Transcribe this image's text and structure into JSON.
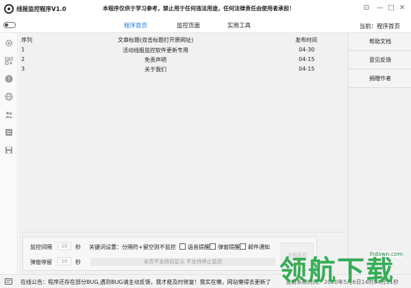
{
  "window": {
    "title": "线报监控程序V1.0",
    "notice": "本程序仅供于学习参考，禁止用于任何违法用途，任何法律责任由使用者承担！",
    "pin_glyph": "⊡",
    "minimize_glyph": "—",
    "maximize_glyph": "□",
    "close_glyph": "✕"
  },
  "nav": {
    "tabs": [
      {
        "label": "程序首页",
        "active": true
      },
      {
        "label": "监控页面",
        "active": false
      },
      {
        "label": "实用工具",
        "active": false
      }
    ],
    "current": "当前：程序首页"
  },
  "table": {
    "headers": [
      "序列",
      "文章标题(双击标题打开原网址)",
      "发布时间"
    ],
    "rows": [
      {
        "seq": "1",
        "title": "活动线报监控软件更新专用",
        "date": "04-30"
      },
      {
        "seq": "2",
        "title": "免责声明",
        "date": "04-15"
      },
      {
        "seq": "3",
        "title": "关于我们",
        "date": "04-15"
      }
    ]
  },
  "rightbar": {
    "buttons": [
      "帮助文档",
      "意见反馈",
      "捐赠作者"
    ]
  },
  "settings": {
    "interval_label": "监控间隔",
    "interval_value": "10",
    "interval_unit": "秒",
    "stay_label": "弹窗停留",
    "stay_value": "10",
    "stay_unit": "秒",
    "keyword_label": "关键词设置：分隔符+留空则不监控",
    "voice_label": "语音提醒",
    "popup_label": "弹窗提醒",
    "mail_label": "邮件通知",
    "hint": "本页不支持自定义 不支持停止监控",
    "action_label": "开始监控"
  },
  "status": {
    "left": "在线公告：程序还存在部分BUG,遇到BUG请主动反馈，我才能及时修复！我实在懒，网站懒得去更新了",
    "right": "当前系统时间：2020年5月6日14时54分21秒"
  },
  "watermark": {
    "text": "领航下载",
    "url": "lhdown.com"
  },
  "colors": {
    "accent": "#1a7bd6",
    "watermark": "#27a84a"
  }
}
